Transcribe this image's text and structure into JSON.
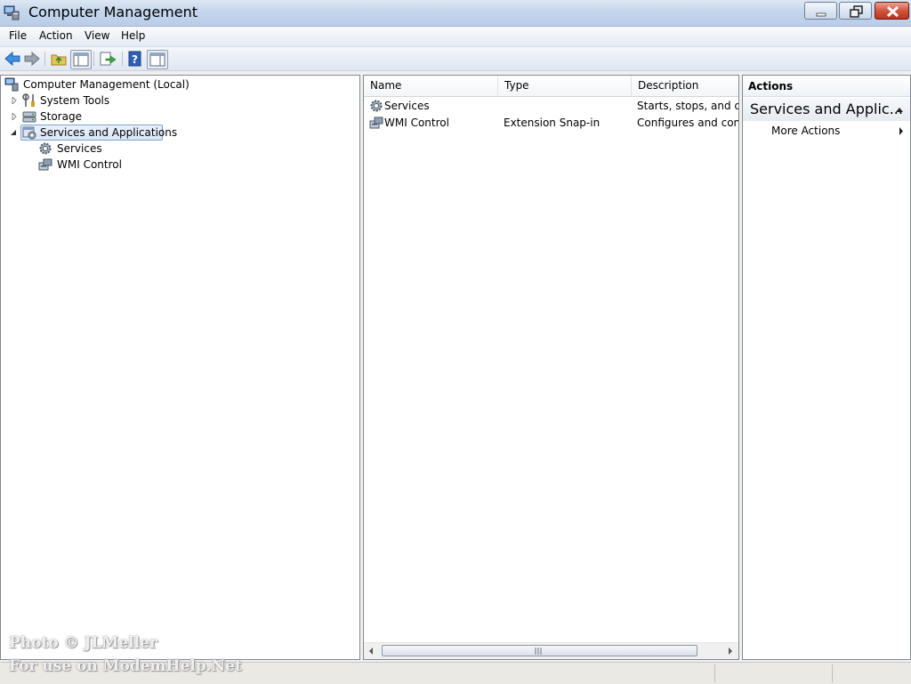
{
  "window": {
    "title": "Computer Management"
  },
  "menu": [
    "File",
    "Action",
    "View",
    "Help"
  ],
  "toolbar": {
    "buttons": [
      "back-arrow-icon",
      "forward-arrow-icon",
      "up-folder-icon",
      "show-hide-console-tree-icon",
      "export-list-icon",
      "help-icon",
      "show-hide-action-pane-icon"
    ]
  },
  "tree": {
    "root": "Computer Management (Local)",
    "items": [
      {
        "label": "System Tools",
        "icon": "tools-icon",
        "expanded": false
      },
      {
        "label": "Storage",
        "icon": "storage-icon",
        "expanded": false
      },
      {
        "label": "Services and Applications",
        "icon": "services-apps-icon",
        "expanded": true,
        "selected": true
      },
      {
        "label": "Services",
        "icon": "gear-icon"
      },
      {
        "label": "WMI Control",
        "icon": "wmi-icon"
      }
    ]
  },
  "list": {
    "columns": [
      "Name",
      "Type",
      "Description"
    ],
    "rows": [
      {
        "name": "Services",
        "type": "",
        "description": "Starts, stops, and configures Windows services."
      },
      {
        "name": "WMI Control",
        "type": "Extension Snap-in",
        "description": "Configures and controls the Windows Management Instrumentation service."
      }
    ]
  },
  "actions": {
    "header": "Actions",
    "section_title": "Services and Applic...",
    "more": "More Actions"
  },
  "watermark": {
    "line1": "Photo © JLMeller",
    "line2": "For use on ModemHelp.Net"
  },
  "colors": {
    "titlebar": "#c4d6ec",
    "close_button": "#c0311a",
    "selection": "#d9e7f7"
  }
}
